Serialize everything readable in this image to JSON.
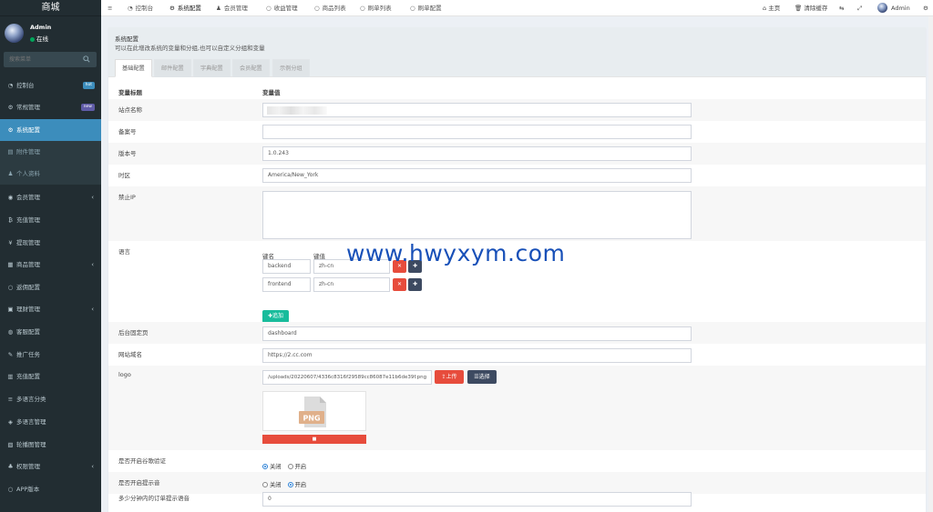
{
  "sidebar": {
    "brand": "商城",
    "user_name": "Admin",
    "user_status": "在线",
    "search_placeholder": "搜索菜单",
    "items": [
      {
        "label": "控制台",
        "icon": "dashboard-icon",
        "badge": "hot",
        "badge_color": "#3c8dbc"
      },
      {
        "label": "常规管理",
        "icon": "cogs-icon",
        "badge": "new",
        "badge_color": "#605ca8"
      },
      {
        "label": "系统配置",
        "icon": "gear-icon",
        "active": true
      },
      {
        "label": "附件管理",
        "icon": "file-icon"
      },
      {
        "label": "个人资料",
        "icon": "user-icon"
      },
      {
        "label": "会员管理",
        "icon": "user-circle-icon",
        "chevron": true
      },
      {
        "label": "充值管理",
        "icon": "bitcoin-icon"
      },
      {
        "label": "提现管理",
        "icon": "yen-icon"
      },
      {
        "label": "商品管理",
        "icon": "cart-icon",
        "chevron": true
      },
      {
        "label": "返佣配置",
        "icon": "circle-icon"
      },
      {
        "label": "理财管理",
        "icon": "archive-icon",
        "chevron": true
      },
      {
        "label": "客服配置",
        "icon": "headset-icon"
      },
      {
        "label": "推广任务",
        "icon": "bullhorn-icon"
      },
      {
        "label": "充值配置",
        "icon": "grid-icon"
      },
      {
        "label": "多语言分类",
        "icon": "bars-icon"
      },
      {
        "label": "多语言管理",
        "icon": "globe-icon"
      },
      {
        "label": "轮播图管理",
        "icon": "image-icon"
      },
      {
        "label": "权限管理",
        "icon": "users-icon",
        "chevron": true
      },
      {
        "label": "APP版本",
        "icon": "circle-icon"
      }
    ]
  },
  "topnav": {
    "tabs": [
      {
        "label": "控制台",
        "icon": "dashboard-icon"
      },
      {
        "label": "系统配置",
        "icon": "gear-icon",
        "active": true
      },
      {
        "label": "会员管理",
        "icon": "user-icon"
      },
      {
        "label": "收益管理",
        "icon": "circle-icon"
      },
      {
        "label": "商品列表",
        "icon": "circle-icon"
      },
      {
        "label": "刷单列表",
        "icon": "circle-icon"
      },
      {
        "label": "刷单配置",
        "icon": "circle-icon"
      }
    ],
    "home_label": "主页",
    "clear_cache_label": "清除缓存",
    "admin_label": "Admin"
  },
  "panel": {
    "title": "系统配置",
    "description": "可以在此增改系统的变量和分组,也可以自定义分组和变量",
    "tabs": [
      "基础配置",
      "邮件配置",
      "字典配置",
      "会员配置",
      "示例分组"
    ],
    "col_title": "变量标题",
    "col_value": "变量值"
  },
  "fields": {
    "site_name_label": "站点名称",
    "beian_label": "备案号",
    "version_label": "版本号",
    "version_value": "1.0.243",
    "timezone_label": "时区",
    "timezone_value": "America/New_York",
    "forbidden_ip_label": "禁止IP",
    "language_label": "语言",
    "key_header": "键名",
    "value_header": "键值",
    "lang_rows": [
      {
        "key": "backend",
        "value": "zh-cn"
      },
      {
        "key": "frontend",
        "value": "zh-cn"
      }
    ],
    "append_label": "追加",
    "fixed_page_label": "后台固定页",
    "fixed_page_value": "dashboard",
    "domain_label": "网站域名",
    "domain_value": "https://2.cc.com",
    "logo_label": "logo",
    "logo_value": "/uploads/20220607/4336c8316f29589cc86087e11b6de39f.png",
    "upload_label": "上传",
    "choose_label": "选择",
    "png_label": "PNG",
    "captcha_label": "是否开启谷歌验证",
    "sound_label": "是否开启提示音",
    "off_label": "关闭",
    "on_label": "开启",
    "captcha_selected": "关闭",
    "sound_selected": "开启",
    "order_minutes_label": "多少分钟内的订单提示语音",
    "order_minutes_value": "0"
  },
  "watermark": "www.hwyxym.com"
}
